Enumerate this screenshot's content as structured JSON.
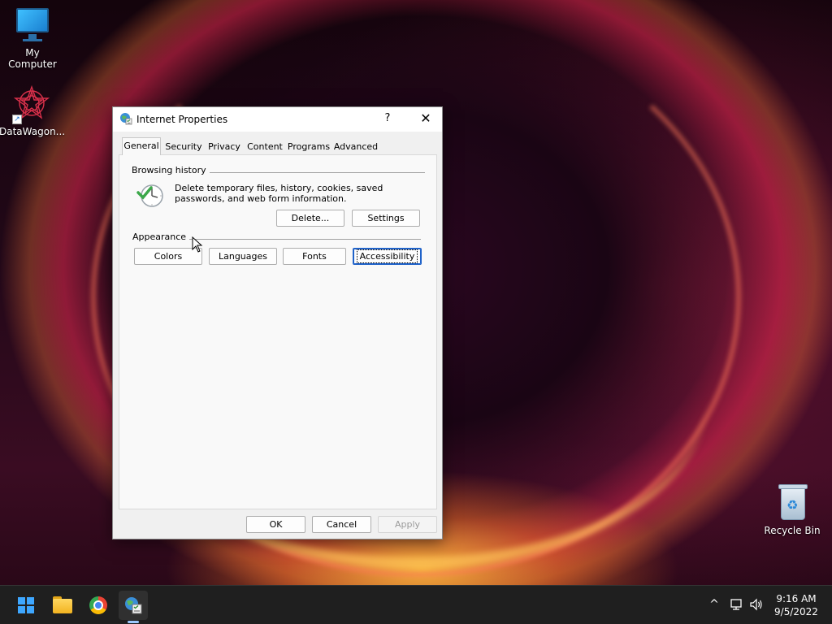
{
  "desktop": {
    "icons": [
      {
        "label": "My Computer",
        "icon": "monitor-icon"
      },
      {
        "label": "DataWagon...",
        "icon": "datawagon-app-icon"
      },
      {
        "label": "Recycle Bin",
        "icon": "recycle-bin-icon"
      }
    ]
  },
  "dialog": {
    "title": "Internet Properties",
    "help_label": "?",
    "close_label": "✕",
    "tabs": [
      {
        "label": "General",
        "active": true
      },
      {
        "label": "Security"
      },
      {
        "label": "Privacy"
      },
      {
        "label": "Content"
      },
      {
        "label": "Programs"
      },
      {
        "label": "Advanced"
      }
    ],
    "browsing_history": {
      "heading": "Browsing history",
      "description": "Delete temporary files, history, cookies, saved passwords, and web form information.",
      "delete_label": "Delete...",
      "settings_label": "Settings"
    },
    "appearance": {
      "heading": "Appearance",
      "colors_label": "Colors",
      "languages_label": "Languages",
      "fonts_label": "Fonts",
      "accessibility_label": "Accessibility"
    },
    "footer": {
      "ok_label": "OK",
      "cancel_label": "Cancel",
      "apply_label": "Apply"
    }
  },
  "taskbar": {
    "apps": [
      "start-icon",
      "file-explorer-icon",
      "chrome-icon",
      "internet-properties-icon"
    ],
    "clock": {
      "time": "9:16 AM",
      "date": "9/5/2022"
    },
    "tray_chevron": "^"
  },
  "colors": {
    "focus_blue": "#1f62c9",
    "taskbar_bg": "#1f1f1f",
    "dialog_bg": "#f0f0f0"
  }
}
